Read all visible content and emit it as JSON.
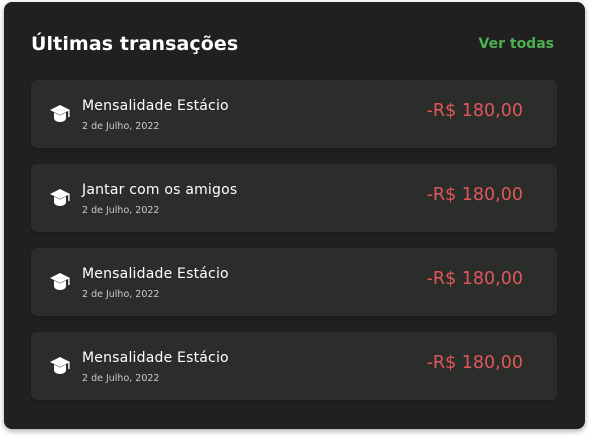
{
  "panel": {
    "title": "Últimas transações",
    "see_all_label": "Ver todas"
  },
  "colors": {
    "background": "#1f201f",
    "row_background": "#2b2d2b",
    "accent_green": "#4caf50",
    "negative_red": "#e05757"
  },
  "transactions": [
    {
      "icon": "graduation-cap-icon",
      "name": "Mensalidade Estácio",
      "date": "2 de Julho, 2022",
      "amount": "-R$ 180,00"
    },
    {
      "icon": "graduation-cap-icon",
      "name": "Jantar com os amigos",
      "date": "2 de Julho, 2022",
      "amount": "-R$ 180,00"
    },
    {
      "icon": "graduation-cap-icon",
      "name": "Mensalidade Estácio",
      "date": "2 de Julho, 2022",
      "amount": "-R$ 180,00"
    },
    {
      "icon": "graduation-cap-icon",
      "name": "Mensalidade Estácio",
      "date": "2 de Julho, 2022",
      "amount": "-R$ 180,00"
    }
  ]
}
